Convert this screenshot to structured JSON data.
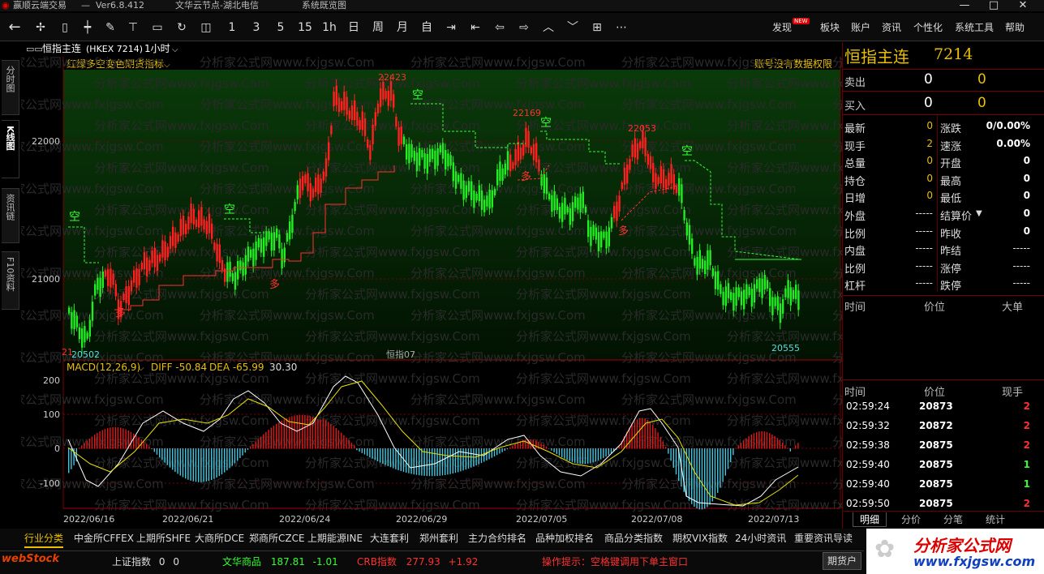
{
  "window": {
    "app_title": "赢顺云端交易",
    "version": "Ver6.8.412",
    "server": "文华云节点-湖北电信",
    "status": "系统既览图",
    "buttons": {
      "minimize": "—",
      "maximize": "□",
      "close": "✕"
    }
  },
  "toolbar": {
    "periods": [
      "1",
      "3",
      "5",
      "15",
      "1h",
      "日",
      "周",
      "月",
      "自"
    ],
    "menus": [
      "发现",
      "板块",
      "账户",
      "资讯",
      "个性化",
      "系统工具",
      "帮助"
    ],
    "new_badge": "NEW",
    "icons": [
      "back-icon",
      "crosshair-icon",
      "candlestick-icon",
      "bar-chart-icon",
      "draw-icon",
      "pin-icon",
      "cycle-icon",
      "refresh-icon",
      "zoom-icon"
    ]
  },
  "instrument_bar": {
    "name": "恒指主连",
    "code": "(HKEX 7214)",
    "period": "1小时",
    "indicator": "红绿多空变色期货指标",
    "permission": "账号没有数据权限",
    "watermark": "分析家公式网www.fxjgsw.Com"
  },
  "left_tabs": [
    "分时图",
    "K线图",
    "资讯链",
    "F10资料"
  ],
  "main_chart": {
    "y_labels": [
      "22000",
      "21000"
    ],
    "price_labels": {
      "high1": "22423",
      "high2": "22169",
      "high3": "22053",
      "low1": "20502",
      "low2": "20555",
      "left_cut": "21"
    },
    "signals": {
      "kong": "空",
      "duo": "多"
    },
    "center_label": "恒指07"
  },
  "macd": {
    "title": "MACD(12,26,9)",
    "diff_label": "DIFF -50.84",
    "dea_label": "DEA -65.99",
    "macd_value": "30.30",
    "y_labels": [
      "200",
      "100",
      "0",
      "-100"
    ]
  },
  "x_dates": [
    "2022/06/16",
    "2022/06/21",
    "2022/06/24",
    "2022/06/29",
    "2022/07/05",
    "2022/07/08",
    "2022/07/13"
  ],
  "quote": {
    "name": "恒指主连",
    "code": "7214",
    "sell": {
      "label": "卖出",
      "price": "0",
      "vol": "0"
    },
    "buy": {
      "label": "买入",
      "price": "0",
      "vol": "0"
    },
    "rows": [
      {
        "l1": "最新",
        "v1": "0",
        "l2": "涨跌",
        "v2": "0/0.00%"
      },
      {
        "l1": "现手",
        "v1": "2",
        "l2": "速涨",
        "v2": "0.00%"
      },
      {
        "l1": "总量",
        "v1": "0",
        "l2": "开盘",
        "v2": "0"
      },
      {
        "l1": "持仓",
        "v1": "0",
        "l2": "最高",
        "v2": "0"
      },
      {
        "l1": "日增",
        "v1": "0",
        "l2": "最低",
        "v2": "0"
      },
      {
        "l1": "外盘",
        "v1": "-----",
        "l2": "结算价",
        "v2": "0"
      },
      {
        "l1": "比例",
        "v1": "-----",
        "l2": "昨收",
        "v2": "0"
      },
      {
        "l1": "内盘",
        "v1": "-----",
        "l2": "昨结",
        "v2": "-----"
      },
      {
        "l1": "比例",
        "v1": "-----",
        "l2": "涨停",
        "v2": "-----"
      },
      {
        "l1": "杠杆",
        "v1": "-----",
        "l2": "跌停",
        "v2": "-----"
      }
    ],
    "big_header": [
      "时间",
      "价位",
      "大单"
    ],
    "ticks_header": [
      "时间",
      "价位",
      "现手"
    ],
    "ticks": [
      {
        "time": "02:59:24",
        "price": "20873",
        "vol": "2"
      },
      {
        "time": "02:59:32",
        "price": "20872",
        "vol": "2"
      },
      {
        "time": "02:59:38",
        "price": "20875",
        "vol": "2"
      },
      {
        "time": "02:59:40",
        "price": "20875",
        "vol": "1"
      },
      {
        "time": "02:59:40",
        "price": "20875",
        "vol": "1"
      },
      {
        "time": "02:59:50",
        "price": "20875",
        "vol": "2"
      }
    ],
    "bottom_tabs": [
      "明细",
      "分价",
      "分笔",
      "统计"
    ]
  },
  "bottom": {
    "tabs": [
      "行业分类",
      "中金所CFFEX",
      "上期所SHFE",
      "大商所DCE",
      "郑商所CZCE",
      "上期能源INE",
      "大连套利",
      "郑州套利",
      "主力合约排名",
      "品种加权排名",
      "商品分类指数",
      "期权VIX指数",
      "24小时资讯",
      "重要资讯导读"
    ],
    "logo": "webStock",
    "index1_name": "上证指数",
    "index1_val": "0",
    "index1_chg": "0",
    "index2_name": "文华商品",
    "index2_val": "187.81",
    "index2_chg": "-1.01",
    "index3_name": "CRB指数",
    "index3_val": "277.93",
    "index3_chg": "+1.92",
    "hint": "操作提示：空格键调用下单主窗口",
    "btn": "期货户",
    "brand1": "分析家公式网",
    "brand2": "www.fxjgsw.com"
  },
  "colors": {
    "up": "#ff3030",
    "down": "#30ff30",
    "yellow": "#e8c000",
    "grid": "#7a0000"
  }
}
